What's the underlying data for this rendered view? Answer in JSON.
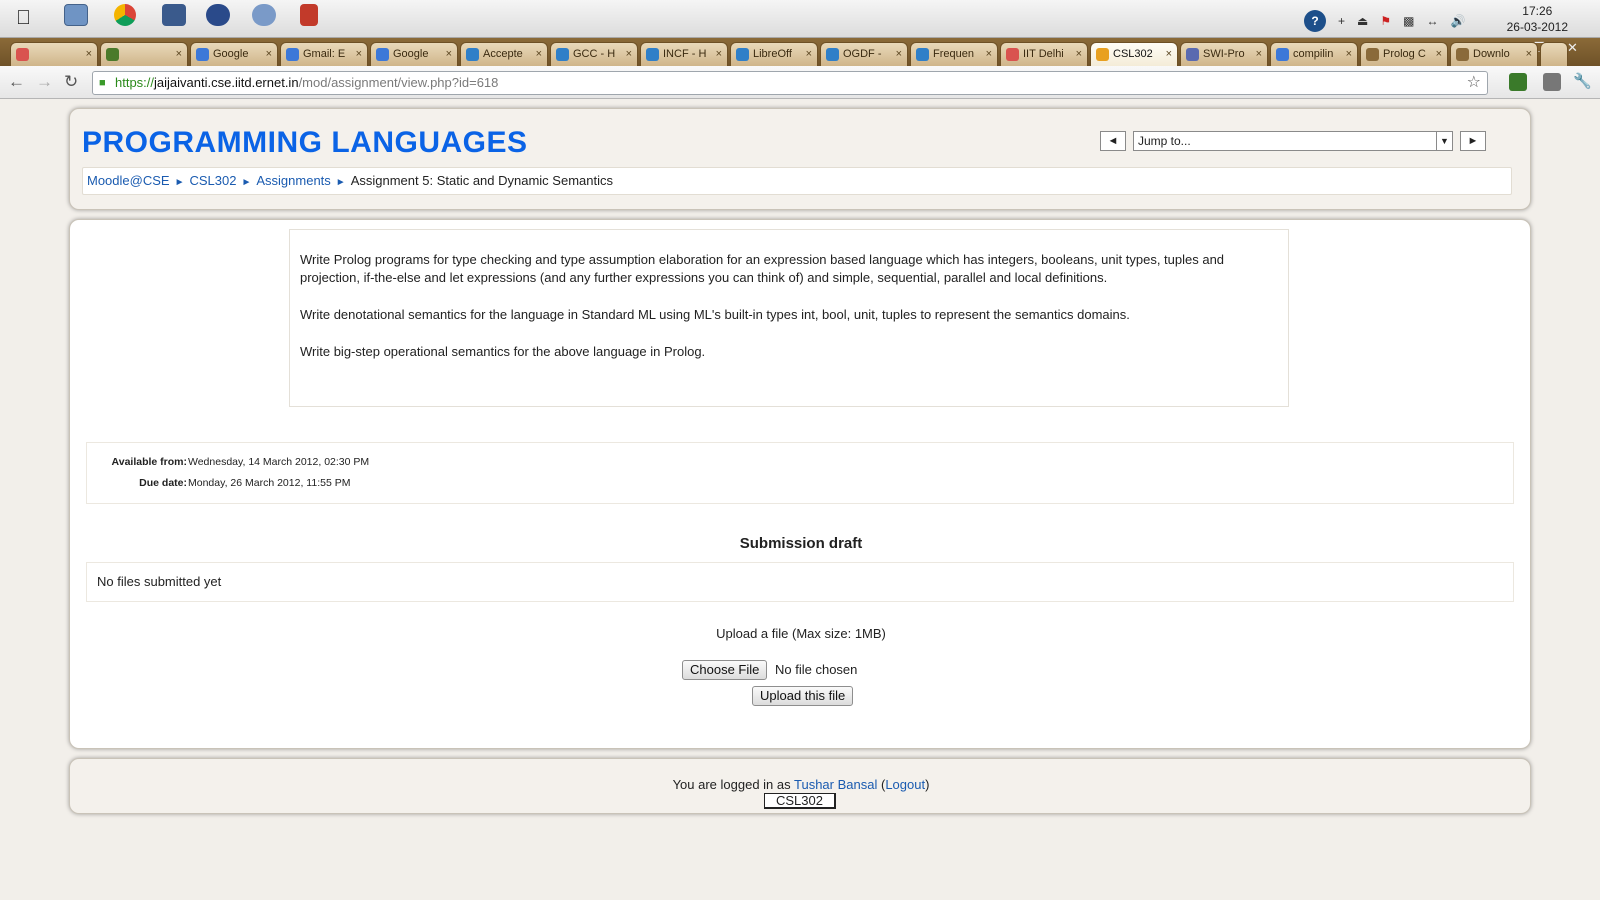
{
  "os": {
    "clock_time": "17:26",
    "clock_date": "26-03-2012"
  },
  "tabs": [
    {
      "label": "",
      "icon": "target-icon",
      "color": "#d9534f"
    },
    {
      "label": "",
      "icon": "app-icon",
      "color": "#4a7a2a"
    },
    {
      "label": "Google",
      "icon": "google-icon",
      "color": "#3c78d8"
    },
    {
      "label": "Gmail: E",
      "icon": "google-icon",
      "color": "#3c78d8"
    },
    {
      "label": "Google",
      "icon": "google-icon",
      "color": "#3c78d8"
    },
    {
      "label": "Accepte",
      "icon": "site-icon",
      "color": "#2f7fc8"
    },
    {
      "label": "GCC - H",
      "icon": "site-icon",
      "color": "#2f7fc8"
    },
    {
      "label": "INCF - H",
      "icon": "site-icon",
      "color": "#2f7fc8"
    },
    {
      "label": "LibreOff",
      "icon": "site-icon",
      "color": "#2f7fc8"
    },
    {
      "label": "OGDF -",
      "icon": "site-icon",
      "color": "#2f7fc8"
    },
    {
      "label": "Frequen",
      "icon": "site-icon",
      "color": "#2f7fc8"
    },
    {
      "label": "IIT Delhi",
      "icon": "target-icon",
      "color": "#d9534f"
    },
    {
      "label": "CSL302",
      "icon": "moodle-icon",
      "color": "#e8a020",
      "active": true
    },
    {
      "label": "SWI-Pro",
      "icon": "owl-icon",
      "color": "#5a6ab0"
    },
    {
      "label": "compilin",
      "icon": "google-icon",
      "color": "#3c78d8"
    },
    {
      "label": "Prolog C",
      "icon": "globe-icon",
      "color": "#8a6a3a"
    },
    {
      "label": "Downlo",
      "icon": "download-icon",
      "color": "#8a6a3a"
    }
  ],
  "address": {
    "scheme": "https://",
    "host": "jaijaivanti.cse.iitd.ernet.in",
    "path": "/mod/assignment/view.php?id=618"
  },
  "header": {
    "title": "PROGRAMMING LANGUAGES",
    "jump_placeholder": "Jump to...",
    "prev": "◄",
    "next": "►"
  },
  "breadcrumb": {
    "items": [
      "Moodle@CSE",
      "CSL302",
      "Assignments"
    ],
    "current": "Assignment 5: Static and Dynamic Semantics",
    "separator": "►"
  },
  "assignment": {
    "paragraphs": [
      "Write Prolog programs for type checking and type assumption elaboration for an expression based language which has integers, booleans, unit types, tuples and projection, if-the-else and let expressions (and any further expressions you can think of) and simple, sequential, parallel and local definitions.",
      "Write denotational semantics for the language in Standard ML using ML's built-in types int, bool, unit, tuples to represent the semantics domains.",
      "Write big-step operational semantics for the above language in Prolog."
    ],
    "available_label": "Available from:",
    "available_value": "Wednesday, 14 March 2012, 02:30 PM",
    "due_label": "Due date:",
    "due_value": "Monday, 26 March 2012, 11:55 PM"
  },
  "submission": {
    "heading": "Submission draft",
    "files_status": "No files submitted yet",
    "upload_label": "Upload a file (Max size: 1MB)",
    "choose_button": "Choose File",
    "no_file": "No file chosen",
    "upload_button": "Upload this file"
  },
  "footer": {
    "logged_in_prefix": "You are logged in as",
    "user": "Tushar Bansal",
    "logout": "Logout",
    "course": "CSL302"
  },
  "colors": {
    "title": "#0a63e6",
    "link": "#1a5bb0",
    "tabstrip": "#7a5a2c"
  }
}
